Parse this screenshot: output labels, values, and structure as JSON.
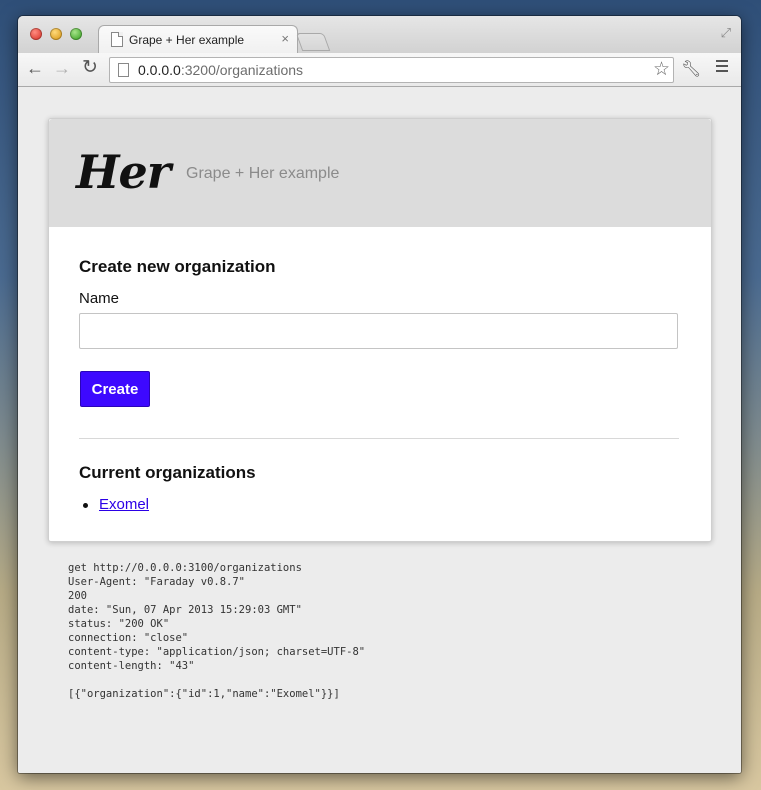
{
  "browser": {
    "tab_title": "Grape + Her example",
    "tab_close_label": "×",
    "url_host": "0.0.0.0",
    "url_rest": ":3200/organizations"
  },
  "header": {
    "logo_text": "Her",
    "subtitle": "Grape + Her example"
  },
  "form": {
    "heading": "Create new organization",
    "name_label": "Name",
    "name_value": "",
    "submit_label": "Create"
  },
  "organizations": {
    "heading": "Current organizations",
    "items": [
      {
        "name": "Exomel"
      }
    ]
  },
  "request_log": [
    "get http://0.0.0.0:3100/organizations",
    "User-Agent: \"Faraday v0.8.7\"",
    "200",
    "date: \"Sun, 07 Apr 2013 15:29:03 GMT\"",
    "status: \"200 OK\"",
    "connection: \"close\"",
    "content-type: \"application/json; charset=UTF-8\"",
    "content-length: \"43\"",
    "",
    "[{\"organization\":{\"id\":1,\"name\":\"Exomel\"}}]"
  ],
  "colors": {
    "accent": "#3d09ff",
    "link": "#2b00e6",
    "header_bg": "#dcdcdc"
  },
  "icons": [
    "document-icon",
    "tab-close-icon",
    "back-arrow-icon",
    "forward-arrow-icon",
    "reload-icon",
    "star-icon",
    "wrench-icon",
    "menu-icon",
    "fullscreen-icon"
  ]
}
